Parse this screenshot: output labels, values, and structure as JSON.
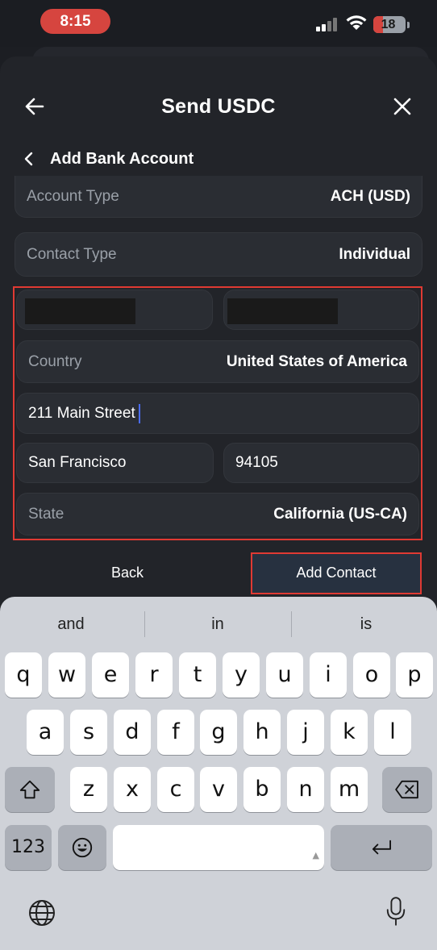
{
  "status": {
    "time": "8:15",
    "battery": "18"
  },
  "header": {
    "title": "Send USDC"
  },
  "subheader": {
    "title": "Add Bank Account"
  },
  "fields": {
    "account_type": {
      "label": "Account Type",
      "value": "ACH (USD)"
    },
    "contact_type": {
      "label": "Contact Type",
      "value": "Individual"
    },
    "country": {
      "label": "Country",
      "value": "United States of America"
    },
    "address": {
      "value": "211 Main Street"
    },
    "city": {
      "value": "San Francisco"
    },
    "zip": {
      "value": "94105"
    },
    "state": {
      "label": "State",
      "value": "California (US-CA)"
    }
  },
  "actions": {
    "back_label": "Back",
    "add_label": "Add Contact"
  },
  "keyboard": {
    "suggestions": [
      "and",
      "in",
      "is"
    ],
    "row1": [
      "q",
      "w",
      "e",
      "r",
      "t",
      "y",
      "u",
      "i",
      "o",
      "p"
    ],
    "row2": [
      "a",
      "s",
      "d",
      "f",
      "g",
      "h",
      "j",
      "k",
      "l"
    ],
    "row3": [
      "z",
      "x",
      "c",
      "v",
      "b",
      "n",
      "m"
    ],
    "numbers_label": "123"
  },
  "colors": {
    "highlight": "#e03a33",
    "background": "#1c1e23",
    "field": "#2a2d33",
    "keyboard": "#cfd2d8"
  }
}
